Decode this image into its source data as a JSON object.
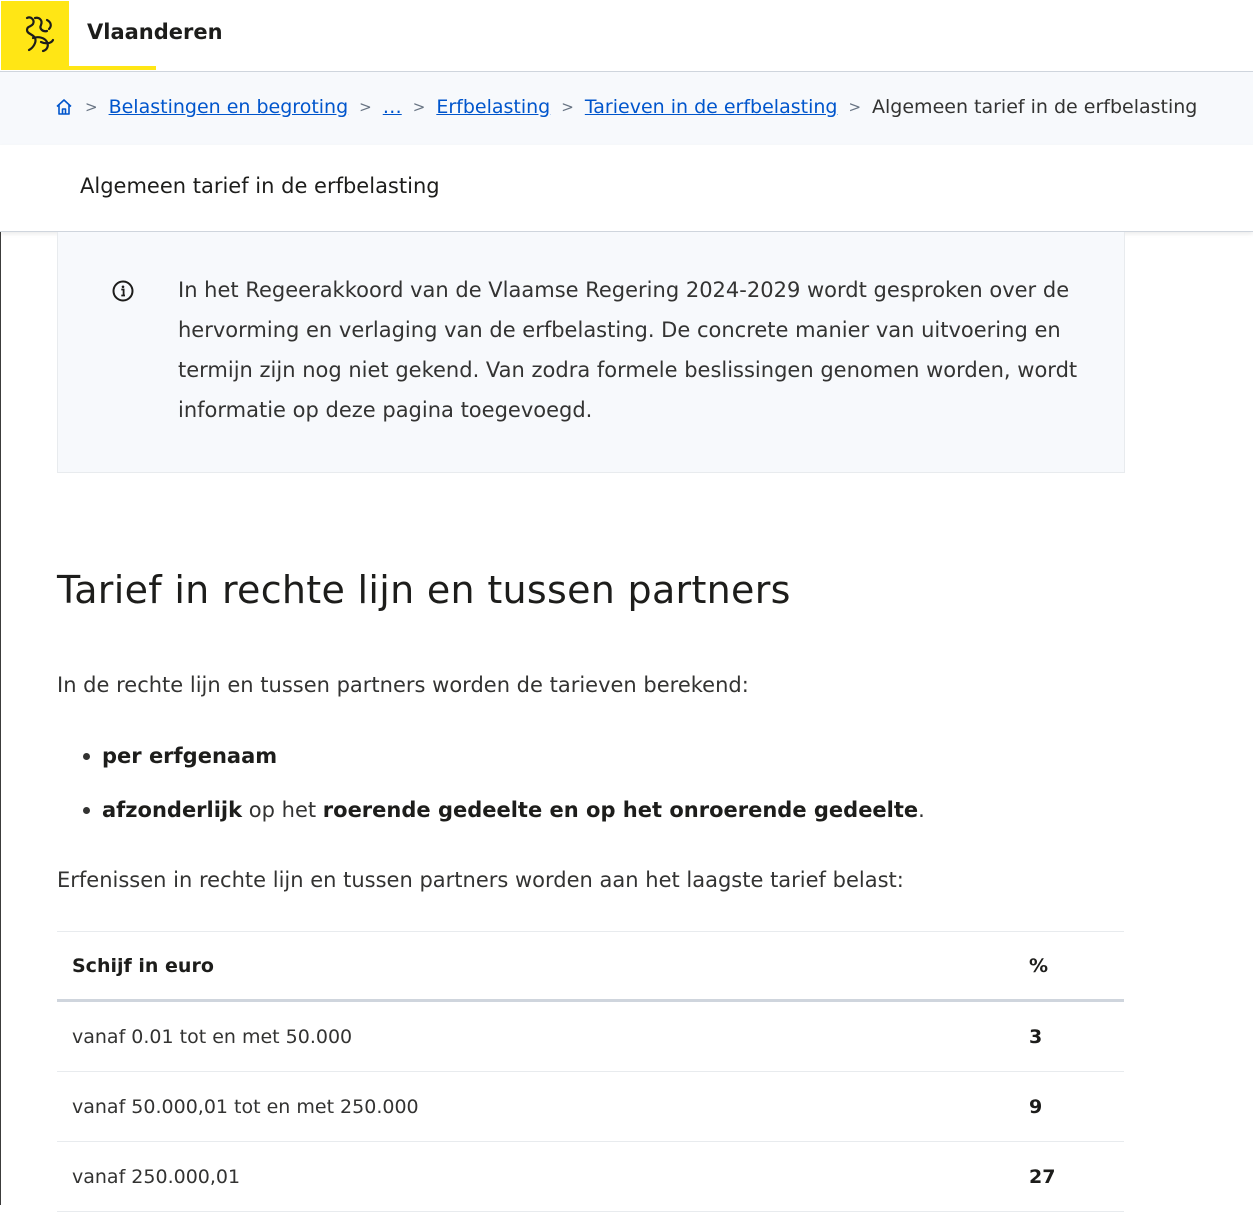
{
  "header": {
    "brand": "Vlaanderen"
  },
  "breadcrumb": {
    "items": [
      "Belastingen en begroting",
      "…",
      "Erfbelasting",
      "Tarieven in de erfbelasting"
    ],
    "current": "Algemeen tarief in de erfbelasting"
  },
  "page_title": "Algemeen tarief in de erfbelasting",
  "info": {
    "icon": "info-icon",
    "text": "In het Regeerakkoord van de Vlaamse Regering 2024-2029 wordt gesproken over de hervorming en verlaging van de erfbelasting. De concrete manier van uitvoering en termijn zijn nog niet gekend. Van zodra formele beslissingen genomen worden, wordt informatie op deze pagina toegevoegd."
  },
  "section": {
    "heading": "Tarief in rechte lijn en tussen partners",
    "lead": "In de rechte lijn en tussen partners worden de tarieven berekend:",
    "bullet1": "per erfgenaam",
    "bullet2_a": "afzonderlijk",
    "bullet2_b": " op het ",
    "bullet2_c": "roerende gedeelte en op het onroerende gedeelte",
    "bullet2_d": ".",
    "lead2": "Erfenissen in rechte lijn en tussen partners worden aan het laagste tarief belast:"
  },
  "table": {
    "headers": [
      "Schijf in euro",
      "%"
    ],
    "rows": [
      [
        "vanaf 0.01 tot en met 50.000",
        "3"
      ],
      [
        "vanaf 50.000,01 tot en met 250.000",
        "9"
      ],
      [
        "vanaf 250.000,01",
        "27"
      ]
    ]
  },
  "colors": {
    "brand_yellow": "#ffe615",
    "link": "#0055cc",
    "info_bg": "#f7f9fc"
  }
}
